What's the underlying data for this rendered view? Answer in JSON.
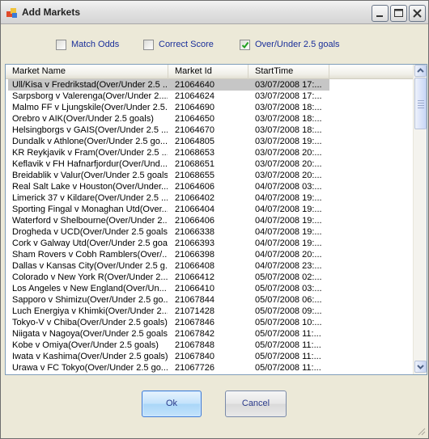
{
  "window": {
    "title": "Add Markets",
    "icons": {
      "app": "app-icon",
      "minimize": "minimize-icon",
      "maximize": "maximize-icon",
      "close": "close-icon"
    },
    "colors": {
      "selection": "#c6c6c6",
      "default_button_border": "#3f7ad6",
      "checkbox_text": "#1a2f9a"
    }
  },
  "filters": [
    {
      "label": "Match Odds",
      "checked": false
    },
    {
      "label": "Correct Score",
      "checked": false
    },
    {
      "label": "Over/Under 2.5 goals",
      "checked": true
    }
  ],
  "table": {
    "columns": [
      "Market Name",
      "Market Id",
      "StartTime"
    ],
    "selected_index": 0,
    "rows": [
      [
        "Ull/Kisa v Fredrikstad(Over/Under 2.5 ...",
        "21064640",
        "03/07/2008 17:..."
      ],
      [
        "Sarpsborg v Valerenga(Over/Under 2....",
        "21064624",
        "03/07/2008 17:..."
      ],
      [
        "Malmo FF v Ljungskile(Over/Under 2.5...",
        "21064690",
        "03/07/2008 18:..."
      ],
      [
        "Orebro v AIK(Over/Under 2.5 goals)",
        "21064650",
        "03/07/2008 18:..."
      ],
      [
        "Helsingborgs v GAIS(Over/Under 2.5 ...",
        "21064670",
        "03/07/2008 18:..."
      ],
      [
        "Dundalk v Athlone(Over/Under 2.5 go...",
        "21064805",
        "03/07/2008 19:..."
      ],
      [
        "KR Reykjavik v Fram(Over/Under 2.5 ...",
        "21068653",
        "03/07/2008 20:..."
      ],
      [
        "Keflavik v FH Hafnarfjordur(Over/Und...",
        "21068651",
        "03/07/2008 20:..."
      ],
      [
        "Breidablik v Valur(Over/Under 2.5 goals)",
        "21068655",
        "03/07/2008 20:..."
      ],
      [
        "Real Salt Lake v Houston(Over/Under...",
        "21064606",
        "04/07/2008 03:..."
      ],
      [
        "Limerick 37 v Kildare(Over/Under 2.5 ...",
        "21066402",
        "04/07/2008 19:..."
      ],
      [
        "Sporting Fingal v Monaghan Utd(Over...",
        "21066404",
        "04/07/2008 19:..."
      ],
      [
        "Waterford v Shelbourne(Over/Under 2...",
        "21066406",
        "04/07/2008 19:..."
      ],
      [
        "Drogheda v UCD(Over/Under 2.5 goals)",
        "21066338",
        "04/07/2008 19:..."
      ],
      [
        "Cork v Galway Utd(Over/Under 2.5 goals)",
        "21066393",
        "04/07/2008 19:..."
      ],
      [
        "Sham Rovers v Cobh Ramblers(Over/...",
        "21066398",
        "04/07/2008 20:..."
      ],
      [
        "Dallas v Kansas City(Over/Under 2.5 g...",
        "21066408",
        "04/07/2008 23:..."
      ],
      [
        "Colorado v New York R(Over/Under 2....",
        "21066412",
        "05/07/2008 02:..."
      ],
      [
        "Los Angeles v New England(Over/Un...",
        "21066410",
        "05/07/2008 03:..."
      ],
      [
        "Sapporo v Shimizu(Over/Under 2.5 go...",
        "21067844",
        "05/07/2008 06:..."
      ],
      [
        "Luch Energiya v Khimki(Over/Under 2....",
        "21071428",
        "05/07/2008 09:..."
      ],
      [
        "Tokyo-V v Chiba(Over/Under 2.5 goals)",
        "21067846",
        "05/07/2008 10:..."
      ],
      [
        "Niigata v Nagoya(Over/Under 2.5 goals)",
        "21067842",
        "05/07/2008 11:..."
      ],
      [
        "Kobe v Omiya(Over/Under 2.5 goals)",
        "21067848",
        "05/07/2008 11:..."
      ],
      [
        "Iwata v Kashima(Over/Under 2.5 goals)",
        "21067840",
        "05/07/2008 11:..."
      ],
      [
        "Urawa v FC Tokyo(Over/Under 2.5 go...",
        "21067726",
        "05/07/2008 11:..."
      ],
      [
        "",
        "",
        ""
      ]
    ]
  },
  "buttons": {
    "ok": "Ok",
    "cancel": "Cancel"
  }
}
